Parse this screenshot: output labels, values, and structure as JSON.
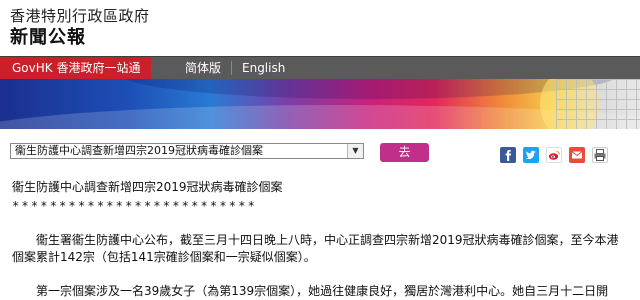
{
  "masthead": {
    "org": "香港特別行政區政府",
    "title": "新聞公報"
  },
  "navbar": {
    "govhk": "GovHK 香港政府一站通",
    "simplified": "简体版",
    "english": "English"
  },
  "selector": {
    "selected": "衞生防護中心調查新增四宗2019冠狀病毒確診個案",
    "go": "去"
  },
  "share": {
    "icons": [
      "facebook-icon",
      "twitter-icon",
      "weibo-icon",
      "email-icon",
      "print-icon"
    ]
  },
  "article": {
    "title": "衞生防護中心調查新增四宗2019冠狀病毒確診個案",
    "stars": "**************************",
    "p1_line1": "　　衞生署衞生防護中心公布，截至三月十四日晚上八時，中心正調查四宗新增2019冠狀病毒確診個案，至今本港",
    "p1_line2": "個案累計142宗（包括141宗確診個案和一宗疑似個案）。",
    "p2_line1": "　　第一宗個案涉及一名39歲女子（為第139宗個案），她過往健康良好，獨居於灣港利中心。她自三月十二日開"
  },
  "colors": {
    "nav_bg": "#5a5a5a",
    "govhk_red": "#c9202a",
    "go_button": "#c0308b"
  }
}
